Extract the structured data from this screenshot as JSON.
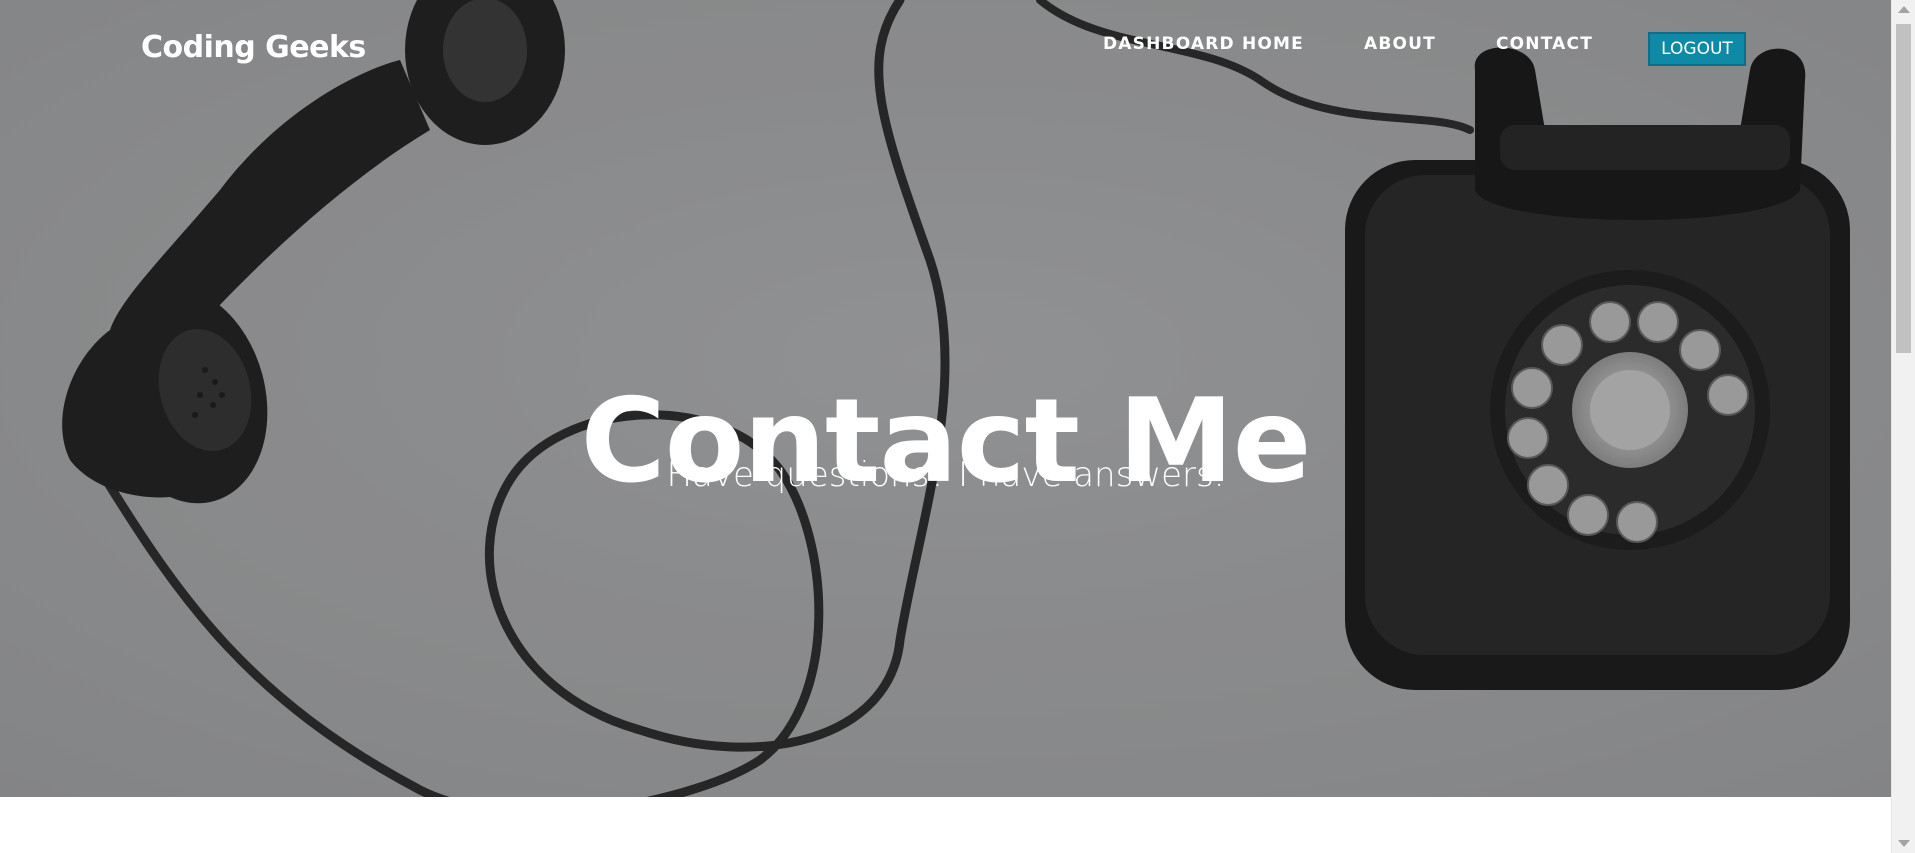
{
  "brand": {
    "name": "Coding Geeks"
  },
  "nav": {
    "items": [
      {
        "label": "DASHBOARD HOME"
      },
      {
        "label": "ABOUT"
      },
      {
        "label": "CONTACT"
      }
    ],
    "logout_label": "LOGOUT"
  },
  "hero": {
    "heading": "Contact Me",
    "subheading": "Have questions? I have answers.",
    "background_image": "vintage rotary telephone with handset off hook"
  },
  "colors": {
    "hero_gray": "#8b8c8e",
    "logout_bg": "#0f8aa6",
    "text": "#ffffff"
  }
}
